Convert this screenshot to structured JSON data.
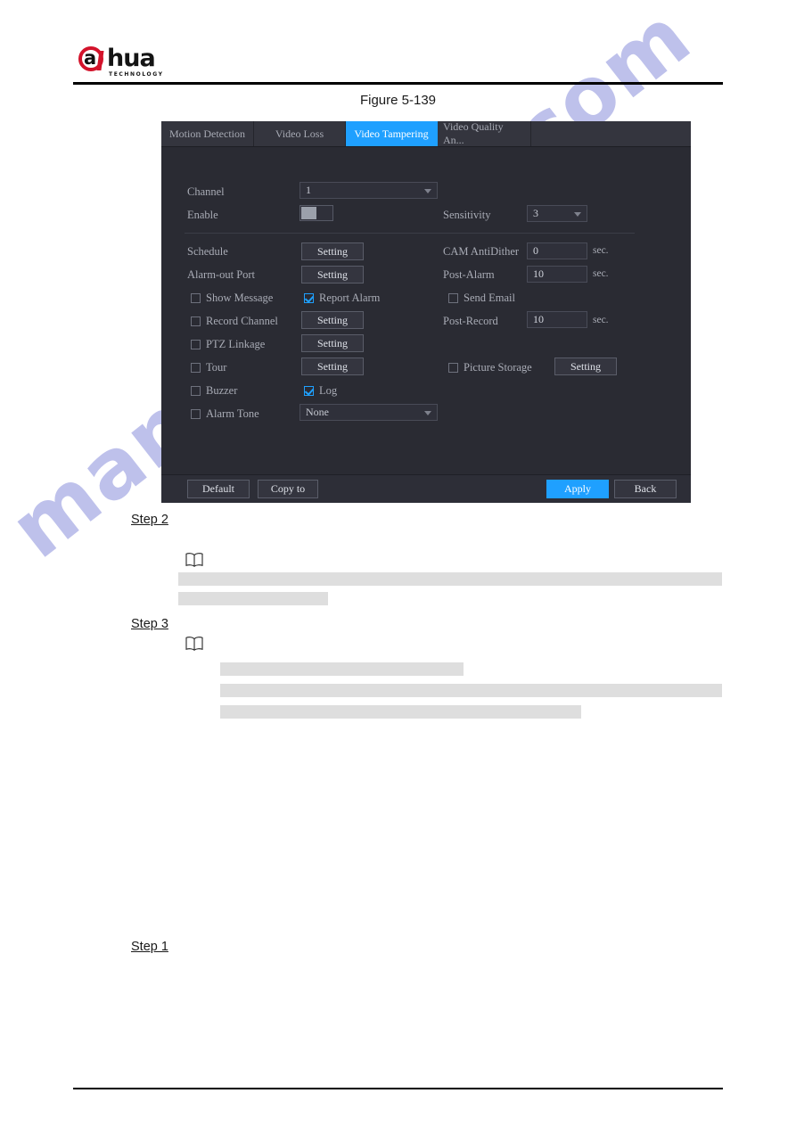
{
  "document": {
    "figure_caption": "Figure 5-139",
    "watermark": "manualshive.com",
    "logo": {
      "letter": "a",
      "word": "hua",
      "subtitle": "TECHNOLOGY"
    },
    "steps": [
      {
        "label": "Step 2"
      },
      {
        "label": "Step 3"
      },
      {
        "label": "Step 1"
      }
    ]
  },
  "nvr": {
    "tabs": [
      {
        "label": "Motion Detection",
        "active": false
      },
      {
        "label": "Video Loss",
        "active": false
      },
      {
        "label": "Video Tampering",
        "active": true
      },
      {
        "label": "Video Quality An...",
        "active": false
      }
    ],
    "fields": {
      "channel_label": "Channel",
      "channel_value": "1",
      "enable_label": "Enable",
      "enable_value": "off",
      "sensitivity_label": "Sensitivity",
      "sensitivity_value": "3",
      "schedule_label": "Schedule",
      "schedule_button": "Setting",
      "alarm_out_port_label": "Alarm-out Port",
      "alarm_out_port_button": "Setting",
      "cam_antidither_label": "CAM AntiDither",
      "cam_antidither_value": "0",
      "cam_antidither_unit": "sec.",
      "post_alarm_label": "Post-Alarm",
      "post_alarm_value": "10",
      "post_alarm_unit": "sec.",
      "show_message_label": "Show Message",
      "report_alarm_label": "Report Alarm",
      "send_email_label": "Send Email",
      "record_channel_label": "Record Channel",
      "record_channel_button": "Setting",
      "post_record_label": "Post-Record",
      "post_record_value": "10",
      "post_record_unit": "sec.",
      "ptz_linkage_label": "PTZ Linkage",
      "ptz_linkage_button": "Setting",
      "tour_label": "Tour",
      "tour_button": "Setting",
      "picture_storage_label": "Picture Storage",
      "picture_storage_button": "Setting",
      "buzzer_label": "Buzzer",
      "log_label": "Log",
      "alarm_tone_label": "Alarm Tone",
      "alarm_tone_value": "None"
    },
    "footer": {
      "default_label": "Default",
      "copy_to_label": "Copy to",
      "apply_label": "Apply",
      "back_label": "Back"
    },
    "colors": {
      "accent": "#1fa0ff",
      "panel_bg": "#2a2b33",
      "tabbar_bg": "#34353e"
    }
  }
}
